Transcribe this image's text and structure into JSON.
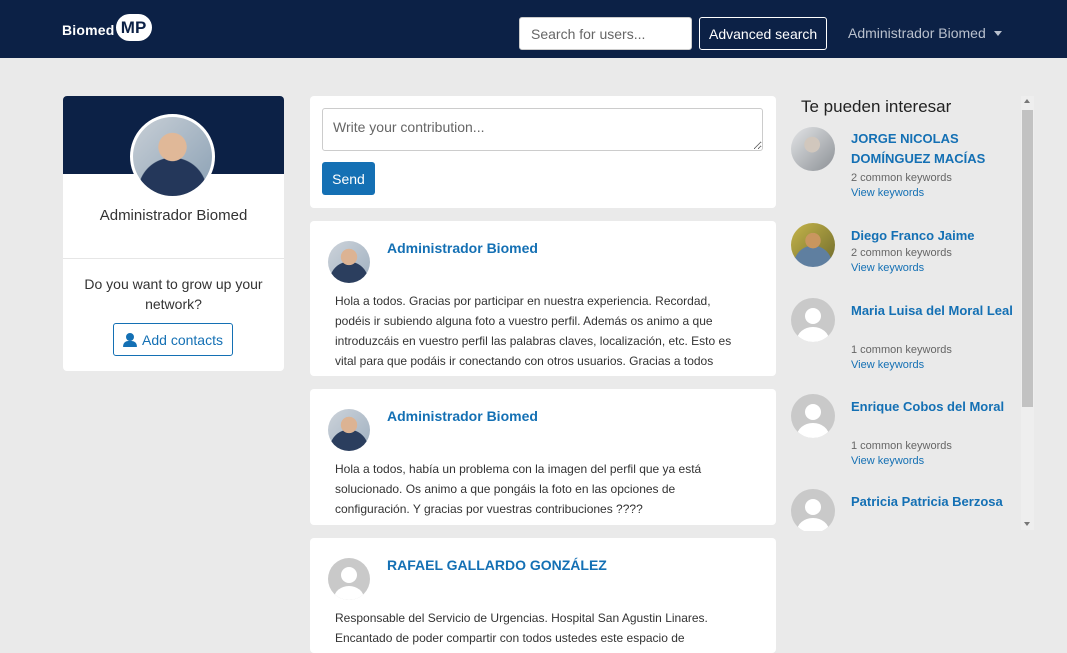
{
  "header": {
    "logo_text": "Biomed",
    "logo_badge": "MP",
    "search_placeholder": "Search for users...",
    "advanced_search": "Advanced search",
    "user_menu": "Administrador Biomed"
  },
  "profile": {
    "name": "Administrador Biomed",
    "grow_prompt": "Do you want to grow up your network?",
    "add_contacts": "Add contacts"
  },
  "compose": {
    "placeholder": "Write your contribution...",
    "send": "Send"
  },
  "posts": [
    {
      "author": "Administrador Biomed",
      "avatar": "admin-photo",
      "body": "Hola a todos. Gracias por participar en nuestra experiencia. Recordad, podéis ir subiendo alguna foto a vuestro perfil. Además os animo a que introduzcáis en vuestro perfil las palabras claves, localización, etc. Esto es vital para que podáis ir conectando con otros usuarios. Gracias a todos"
    },
    {
      "author": "Administrador Biomed",
      "avatar": "admin-photo",
      "body": "Hola a todos, había un problema con la imagen del perfil que ya está solucionado. Os animo a que pongáis la foto en las opciones de configuración. Y gracias por vuestras contribuciones ????"
    },
    {
      "author": "RAFAEL GALLARDO GONZÁLEZ",
      "avatar": "default-avatar",
      "body": "Responsable del Servicio de Urgencias. Hospital San Agustin Linares. Encantado de poder compartir con todos ustedes este espacio de colaboracion e investigacion"
    }
  ],
  "suggestions": {
    "title": "Te pueden interesar",
    "view_keywords": "View keywords",
    "items": [
      {
        "name": "JORGE NICOLAS DOMÍNGUEZ MACÍAS",
        "keywords": "2 common keywords",
        "avatar": "photo-a"
      },
      {
        "name": "Diego Franco Jaime",
        "keywords": "2 common keywords",
        "avatar": "photo-b"
      },
      {
        "name": "Maria Luisa del Moral Leal",
        "keywords": "1 common keywords",
        "avatar": "default-avatar"
      },
      {
        "name": "Enrique Cobos del Moral",
        "keywords": "1 common keywords",
        "avatar": "default-avatar"
      },
      {
        "name": "Patricia Patricia Berzosa",
        "keywords": "",
        "avatar": "default-avatar"
      }
    ]
  },
  "colors": {
    "navbar": "#0c2146",
    "accent": "#1470b4",
    "background": "#eaeaea"
  }
}
